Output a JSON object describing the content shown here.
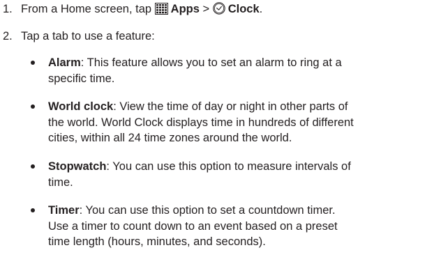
{
  "steps": [
    {
      "number": "1.",
      "prefix": "From a Home screen, tap ",
      "apps_label": "Apps",
      "separator": " > ",
      "clock_label": "Clock",
      "suffix": "."
    },
    {
      "number": "2.",
      "text": "Tap a tab to use a feature:"
    }
  ],
  "features": [
    {
      "term": "Alarm",
      "lines": [
        ": This feature allows you to set an alarm to ring at a",
        "specific time."
      ]
    },
    {
      "term": "World clock",
      "lines": [
        ": View the time of day or night in other parts of",
        "the world. World Clock displays time in hundreds of different",
        "cities, within all 24 time zones around the world."
      ]
    },
    {
      "term": "Stopwatch",
      "lines": [
        ": You can use this option to measure intervals of",
        "time."
      ]
    },
    {
      "term": "Timer",
      "lines": [
        ": You can use this option to set a countdown timer.",
        "Use a timer to count down to an event based on a preset",
        "time length (hours, minutes, and seconds)."
      ]
    }
  ],
  "icons": {
    "apps": "apps-grid-icon",
    "clock": "clock-icon"
  }
}
